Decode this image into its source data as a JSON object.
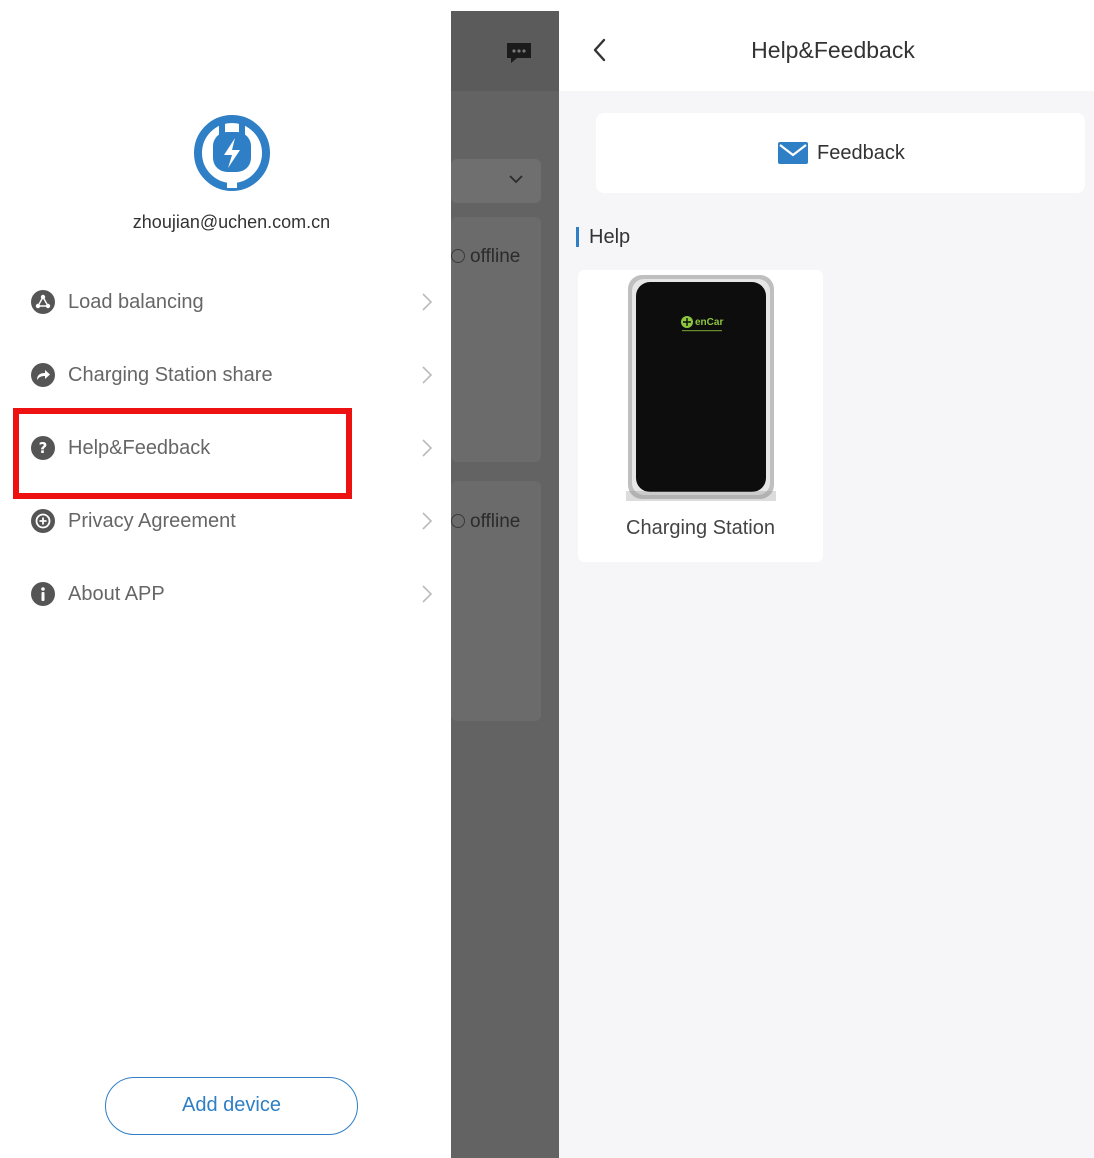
{
  "drawer": {
    "email": "zhoujian@uchen.com.cn",
    "logo_icon": "plug-lightning-icon",
    "menu": [
      {
        "label": "Load balancing",
        "icon": "load-balance-icon"
      },
      {
        "label": "Charging Station share",
        "icon": "share-arrow-icon"
      },
      {
        "label": "Help&Feedback",
        "icon": "question-icon"
      },
      {
        "label": "Privacy Agreement",
        "icon": "plus-circle-icon"
      },
      {
        "label": "About APP",
        "icon": "info-icon"
      }
    ],
    "highlighted_item": "Help&Feedback",
    "add_device_label": "Add device"
  },
  "background_page": {
    "status_1": "offline",
    "status_2": "offline"
  },
  "help_screen": {
    "title": "Help&Feedback",
    "feedback_label": "Feedback",
    "help_section_label": "Help",
    "items": [
      {
        "label": "Charging Station",
        "brand": "enCar"
      }
    ]
  },
  "colors": {
    "accent": "#2f7fc6",
    "highlight": "#ee1111",
    "overlay": "#636363",
    "brand_green": "#8dc63f"
  }
}
